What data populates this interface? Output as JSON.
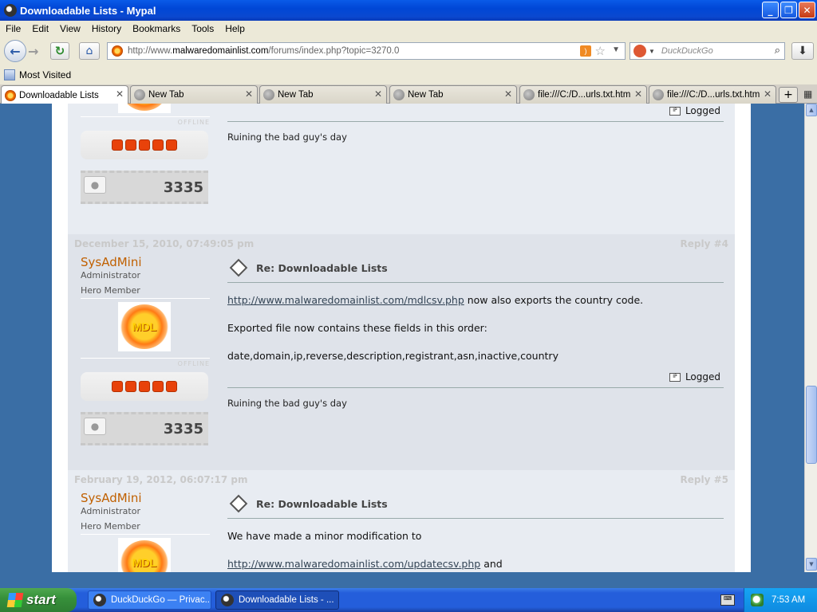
{
  "window": {
    "title": "Downloadable Lists - Mypal"
  },
  "menu": [
    "File",
    "Edit",
    "View",
    "History",
    "Bookmarks",
    "Tools",
    "Help"
  ],
  "nav": {
    "url_prefix": "http://www.",
    "url_domain": "malwaredomainlist.com",
    "url_path": "/forums/index.php?topic=3270.0",
    "search_placeholder": "DuckDuckGo"
  },
  "bookmarks": {
    "most_visited": "Most Visited"
  },
  "tabs": [
    {
      "label": "Downloadable Lists",
      "active": true
    },
    {
      "label": "New Tab"
    },
    {
      "label": "New Tab"
    },
    {
      "label": "New Tab"
    },
    {
      "label": "file:///C:/D...urls.txt.htm"
    },
    {
      "label": "file:///C:/D...urls.txt.htm"
    }
  ],
  "posts": {
    "p3": {
      "status": "OFFLINE",
      "post_count": "3335",
      "logged": "Logged",
      "signature": "Ruining the bad guy's day"
    },
    "p4": {
      "date": "December 15, 2010, 07:49:05 pm",
      "reply": "Reply #4",
      "author": "SysAdMini",
      "group": "Administrator",
      "rank": "Hero Member",
      "avatar_text": "MDL",
      "status": "OFFLINE",
      "post_count": "3335",
      "subject": "Re: Downloadable Lists",
      "link": "http://www.malwaredomainlist.com/mdlcsv.php",
      "line1_rest": " now also exports the country code.",
      "line2": "Exported file now contains these fields in this order:",
      "line3": "date,domain,ip,reverse,description,registrant,asn,inactive,country",
      "logged": "Logged",
      "signature": "Ruining the bad guy's day"
    },
    "p5": {
      "date": "February 19, 2012, 06:07:17 pm",
      "reply": "Reply #5",
      "author": "SysAdMini",
      "group": "Administrator",
      "rank": "Hero Member",
      "avatar_text": "MDL",
      "subject": "Re: Downloadable Lists",
      "line1": "We have made a minor modification to",
      "link": "http://www.malwaredomainlist.com/updatecsv.php",
      "link_rest": " and"
    }
  },
  "taskbar": {
    "start": "start",
    "tasks": [
      "DuckDuckGo — Privac...",
      "Downloadable Lists - ..."
    ],
    "time": "7:53 AM"
  },
  "colors": {
    "accent": "#245edb",
    "author": "#c06000",
    "star": "#e8420a"
  }
}
